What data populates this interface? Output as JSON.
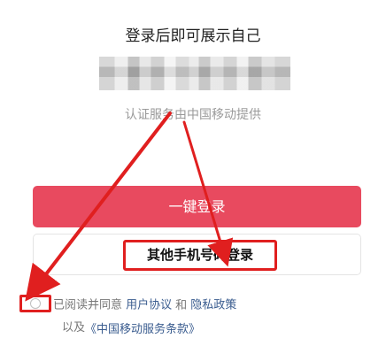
{
  "header": {
    "title": "登录后即可展示自己"
  },
  "account": {
    "provider_note": "认证服务由中国移动提供"
  },
  "actions": {
    "one_click_login_label": "一键登录",
    "other_phone_login_label": "其他手机号码登录"
  },
  "agreement": {
    "prefix": "已阅读并同意",
    "user_agreement_link": "用户协议",
    "and_text": "和",
    "privacy_policy_link": "隐私政策",
    "also_prefix": "以及",
    "carrier_terms_link": "《中国移动服务条款》"
  },
  "colors": {
    "primary": "#e84a5f",
    "annotation": "#e01f1f",
    "link": "#3a5c8f"
  }
}
